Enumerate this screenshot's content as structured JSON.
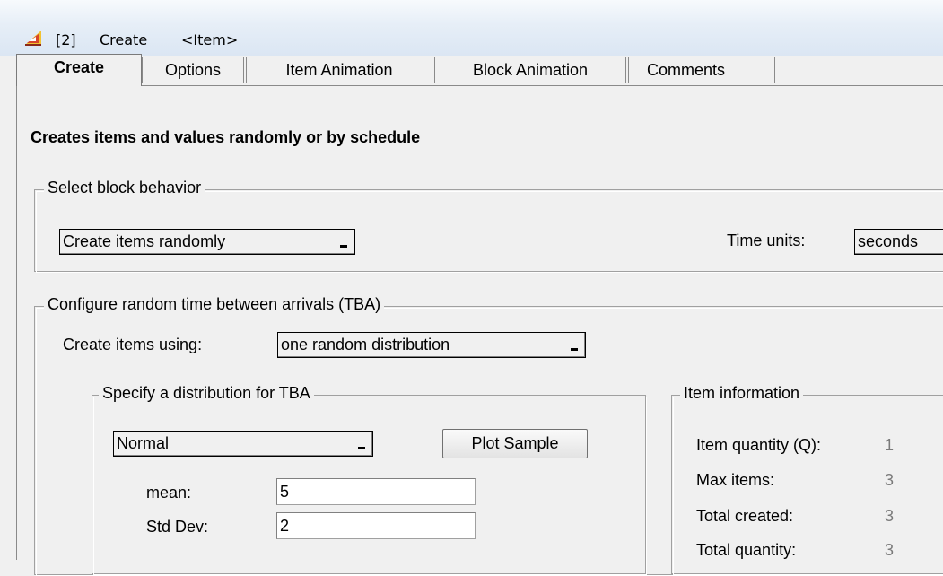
{
  "window": {
    "title_index": "[2]",
    "title_block": "Create",
    "title_item": "<Item>"
  },
  "tabs": [
    {
      "label": "Create",
      "active": true
    },
    {
      "label": "Options"
    },
    {
      "label": "Item Animation"
    },
    {
      "label": "Block Animation"
    },
    {
      "label": "Comments"
    }
  ],
  "heading": "Creates items and values randomly or by schedule",
  "block_behavior": {
    "legend": "Select block behavior",
    "mode_value": "Create items randomly",
    "time_units_label": "Time units:",
    "time_units_value": "seconds"
  },
  "tba": {
    "legend": "Configure random time between arrivals (TBA)",
    "create_using_label": "Create items using:",
    "create_using_value": "one random distribution",
    "distribution": {
      "legend": "Specify a distribution for TBA",
      "value": "Normal",
      "plot_button": "Plot Sample",
      "mean_label": "mean:",
      "mean_value": "5",
      "std_label": "Std Dev:",
      "std_value": "2"
    }
  },
  "item_info": {
    "legend": "Item information",
    "rows": [
      {
        "label": "Item quantity (Q):",
        "value": "1"
      },
      {
        "label": "Max items:",
        "value": "3"
      },
      {
        "label": "Total created:",
        "value": "3"
      },
      {
        "label": "Total quantity:",
        "value": "3"
      }
    ]
  }
}
